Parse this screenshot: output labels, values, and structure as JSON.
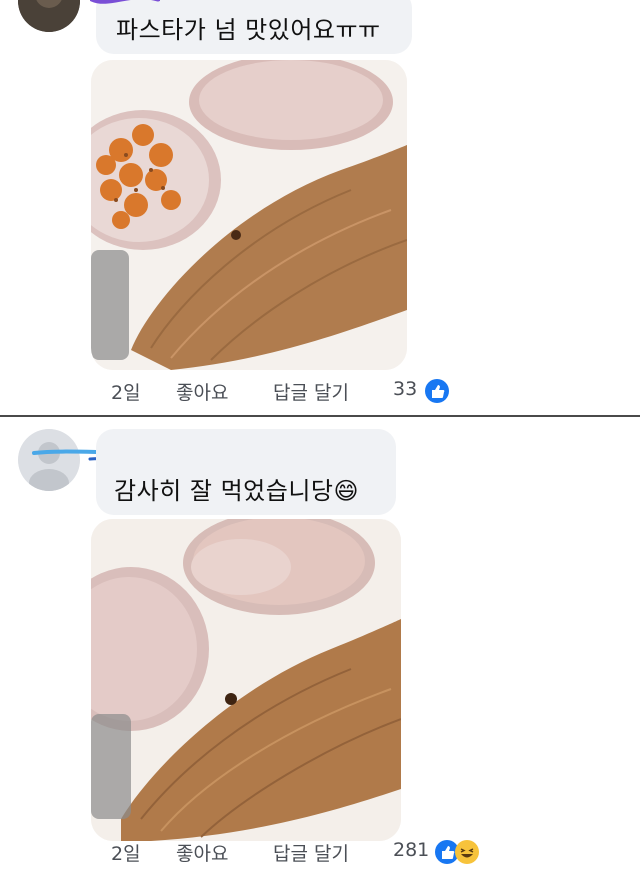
{
  "comments": [
    {
      "text": "파스타가 넘 맛있어요ㅠㅠ",
      "actions": {
        "time": "2일",
        "like": "좋아요",
        "reply": "답글 달기",
        "count": "33"
      },
      "reactions": [
        "like-icon"
      ]
    },
    {
      "text": "감사히 잘 먹었습니당😄",
      "actions": {
        "time": "2일",
        "like": "좋아요",
        "reply": "답글 달기",
        "count": "281"
      },
      "reactions": [
        "like-icon",
        "haha-icon"
      ]
    }
  ],
  "colors": {
    "bubble": "#f0f2f5",
    "like_blue": "#1877f2",
    "haha_yellow": "#f7c33b",
    "scribble_purple": "#7a4fd6",
    "scribble_blue": "#4aa8e8"
  }
}
